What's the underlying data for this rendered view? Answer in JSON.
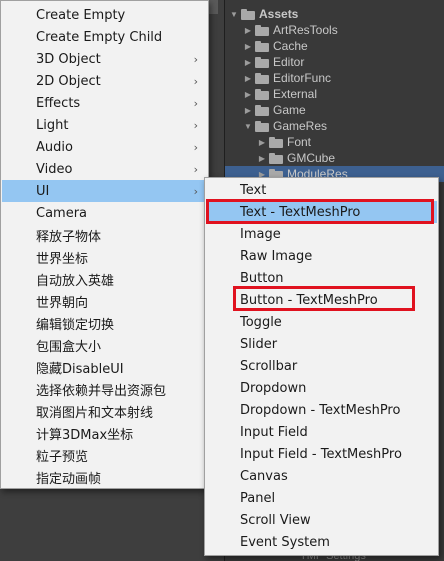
{
  "project": {
    "tree": [
      {
        "label": "Assets",
        "arrow": "▼"
      },
      {
        "label": "ArtResTools",
        "arrow": "▶"
      },
      {
        "label": "Cache",
        "arrow": "▶"
      },
      {
        "label": "Editor",
        "arrow": "▶"
      },
      {
        "label": "EditorFunc",
        "arrow": "▶"
      },
      {
        "label": "External",
        "arrow": "▶"
      },
      {
        "label": "Game",
        "arrow": "▶"
      },
      {
        "label": "GameRes",
        "arrow": "▼"
      },
      {
        "label": "Font",
        "arrow": "▶"
      },
      {
        "label": "GMCube",
        "arrow": "▶"
      },
      {
        "label": "ModuleRes",
        "arrow": "▶"
      }
    ],
    "bottom_peek": "TMP Settings"
  },
  "main_menu": {
    "items": [
      {
        "label": "Create Empty",
        "submenu": false
      },
      {
        "label": "Create Empty Child",
        "submenu": false
      },
      {
        "label": "3D Object",
        "submenu": true
      },
      {
        "label": "2D Object",
        "submenu": true
      },
      {
        "label": "Effects",
        "submenu": true
      },
      {
        "label": "Light",
        "submenu": true
      },
      {
        "label": "Audio",
        "submenu": true
      },
      {
        "label": "Video",
        "submenu": true
      },
      {
        "label": "UI",
        "submenu": true
      },
      {
        "label": "Camera",
        "submenu": false
      },
      {
        "label": "释放子物体",
        "submenu": false
      },
      {
        "label": "世界坐标",
        "submenu": false
      },
      {
        "label": "自动放入英雄",
        "submenu": false
      },
      {
        "label": "世界朝向",
        "submenu": false
      },
      {
        "label": "编辑锁定切换",
        "submenu": false
      },
      {
        "label": "包围盒大小",
        "submenu": false
      },
      {
        "label": "隐藏DisableUI",
        "submenu": false
      },
      {
        "label": "选择依赖并导出资源包",
        "submenu": false
      },
      {
        "label": "取消图片和文本射线",
        "submenu": false
      },
      {
        "label": "计算3DMax坐标",
        "submenu": false
      },
      {
        "label": "粒子预览",
        "submenu": false
      },
      {
        "label": "指定动画帧",
        "submenu": false
      }
    ],
    "chevron": "›"
  },
  "ui_submenu": {
    "items": [
      {
        "label": "Text"
      },
      {
        "label": "Text - TextMeshPro"
      },
      {
        "label": "Image"
      },
      {
        "label": "Raw Image"
      },
      {
        "label": "Button"
      },
      {
        "label": "Button - TextMeshPro"
      },
      {
        "label": "Toggle"
      },
      {
        "label": "Slider"
      },
      {
        "label": "Scrollbar"
      },
      {
        "label": "Dropdown"
      },
      {
        "label": "Dropdown - TextMeshPro"
      },
      {
        "label": "Input Field"
      },
      {
        "label": "Input Field - TextMeshPro"
      },
      {
        "label": "Canvas"
      },
      {
        "label": "Panel"
      },
      {
        "label": "Scroll View"
      },
      {
        "label": "Event System"
      }
    ]
  },
  "colors": {
    "menu_bg": "#f2f2f2",
    "hover": "#94c6f2",
    "highlight_box": "#e0121f",
    "tree_selected": "#3d6090"
  }
}
